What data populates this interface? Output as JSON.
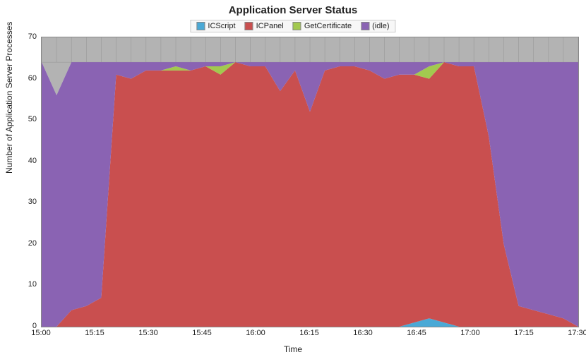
{
  "chart_data": {
    "type": "area",
    "title": "Application Server Status",
    "xlabel": "Time",
    "ylabel": "Number of Application Server Processes",
    "ylim": [
      0,
      70
    ],
    "x_tick_labels": [
      "15:00",
      "15:15",
      "15:30",
      "15:45",
      "16:00",
      "16:15",
      "16:30",
      "16:45",
      "17:00",
      "17:15",
      "17:30"
    ],
    "legend": [
      "ICScript",
      "ICPanel",
      "GetCertificate",
      "(idle)"
    ],
    "colors": {
      "ICScript": "#4aa9d6",
      "ICPanel": "#c94f4f",
      "GetCertificate": "#a2c94f",
      "(idle)": "#8a63b3",
      "above": "#b3b3b3"
    },
    "x": [
      0,
      1,
      2,
      3,
      4,
      5,
      6,
      7,
      8,
      9,
      10,
      11,
      12,
      13,
      14,
      15,
      16,
      17,
      18,
      19,
      20,
      21,
      22,
      23,
      24,
      25,
      26,
      27,
      28,
      29,
      30,
      31,
      32,
      33,
      34,
      35,
      36
    ],
    "series": [
      {
        "name": "ICScript",
        "values": [
          0,
          0,
          0,
          0,
          0,
          0,
          0,
          0,
          0,
          0,
          0,
          0,
          0,
          0,
          0,
          0,
          0,
          0,
          0,
          0,
          0,
          0,
          0,
          0,
          0,
          1,
          2,
          1,
          0,
          0,
          0,
          0,
          0,
          0,
          0,
          0,
          0
        ]
      },
      {
        "name": "ICPanel",
        "values": [
          0,
          0,
          4,
          5,
          7,
          61,
          60,
          62,
          62,
          62,
          62,
          63,
          61,
          64,
          63,
          63,
          57,
          62,
          52,
          62,
          63,
          63,
          62,
          60,
          61,
          60,
          58,
          63,
          63,
          63,
          46,
          20,
          5,
          4,
          3,
          2,
          0
        ]
      },
      {
        "name": "GetCertificate",
        "values": [
          0,
          0,
          0,
          0,
          0,
          0,
          0,
          0,
          0,
          1,
          0,
          0,
          2,
          0,
          0,
          0,
          0,
          0,
          0,
          0,
          0,
          0,
          0,
          0,
          0,
          0,
          3,
          0,
          0,
          0,
          0,
          0,
          0,
          0,
          0,
          0,
          0
        ]
      },
      {
        "name": "(idle)",
        "values": [
          64,
          56,
          60,
          59,
          57,
          3,
          4,
          2,
          2,
          1,
          2,
          1,
          1,
          0,
          1,
          1,
          7,
          2,
          12,
          2,
          1,
          1,
          2,
          4,
          3,
          3,
          1,
          0,
          1,
          1,
          18,
          44,
          59,
          60,
          61,
          62,
          64
        ]
      }
    ]
  }
}
